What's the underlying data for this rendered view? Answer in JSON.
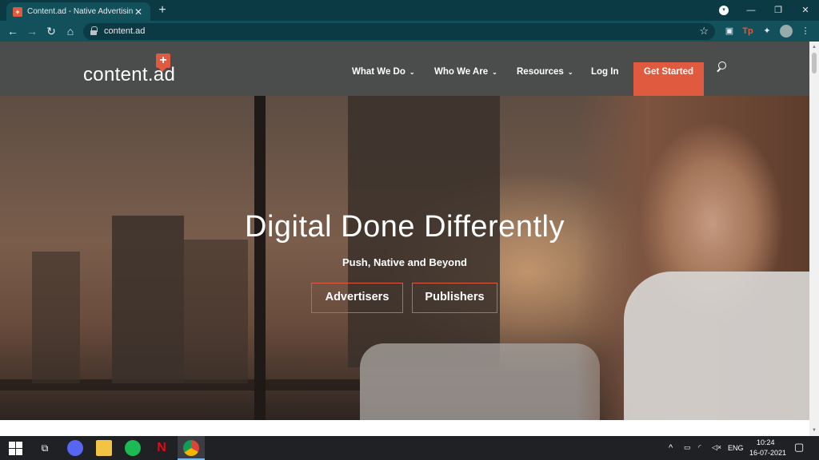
{
  "browser": {
    "tab_title": "Content.ad - Native Advertising,",
    "tab_favicon": "+",
    "tab_close": "✕",
    "new_tab": "+",
    "url": "content.ad",
    "win_minimize": "—",
    "win_restore": "❐",
    "win_close": "✕",
    "ext_tp_label": "Tp"
  },
  "site": {
    "logo_text": "content.ad",
    "logo_plus": "+",
    "nav": [
      {
        "label": "What We Do",
        "chevron": "⌄"
      },
      {
        "label": "Who We Are",
        "chevron": "⌄"
      },
      {
        "label": "Resources",
        "chevron": "⌄"
      },
      {
        "label": "Log In"
      }
    ],
    "cta_label": "Get Started",
    "accent": "#e05a3f",
    "header_bg": "#4b4c4c"
  },
  "hero": {
    "title": "Digital Done Differently",
    "subtitle": "Push, Native and Beyond",
    "buttons": [
      "Advertisers",
      "Publishers"
    ]
  },
  "taskbar": {
    "language": "ENG",
    "time": "10:24",
    "date": "16-07-2021",
    "apps": [
      "task-view-icon",
      "discord-icon",
      "file-explorer-icon",
      "spotify-icon",
      "netflix-icon",
      "chrome-icon"
    ]
  }
}
